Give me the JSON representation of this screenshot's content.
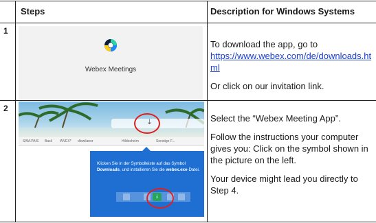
{
  "table": {
    "header": {
      "steps": "Steps",
      "description": "Description for Windows Systems"
    },
    "rows": [
      {
        "number": "1",
        "image_caption": "Webex Meetings",
        "text_intro": "To download the app, go to",
        "link": "https://www.webex.com/de/downloads.html",
        "text_alt": "Or click on our invitation link."
      },
      {
        "number": "2",
        "p1": "Select the “Webex Meeting App”.",
        "p2": "Follow the instructions your computer gives you: Click on the symbol shown in the picture on the left.",
        "p3": "Your device might lead you directly to Step 4."
      }
    ]
  },
  "screenshot": {
    "popup_text_1": "Klicken Sie in der Symbolleiste auf das Symbol ",
    "popup_bold_1": "Downloads",
    "popup_text_2": ", und installieren Sie die ",
    "popup_bold_2": "webex.exe",
    "popup_text_3": "-Datei.",
    "bookmarks": [
      "SAM.PAIS",
      "Basil",
      "WVEX*",
      "dlowilanor",
      "Hildesheim",
      "Sonstige F..."
    ]
  },
  "colors": {
    "accent_blue": "#1e6fd1",
    "link": "#1a3fd1",
    "highlight_circle": "#e02020"
  }
}
